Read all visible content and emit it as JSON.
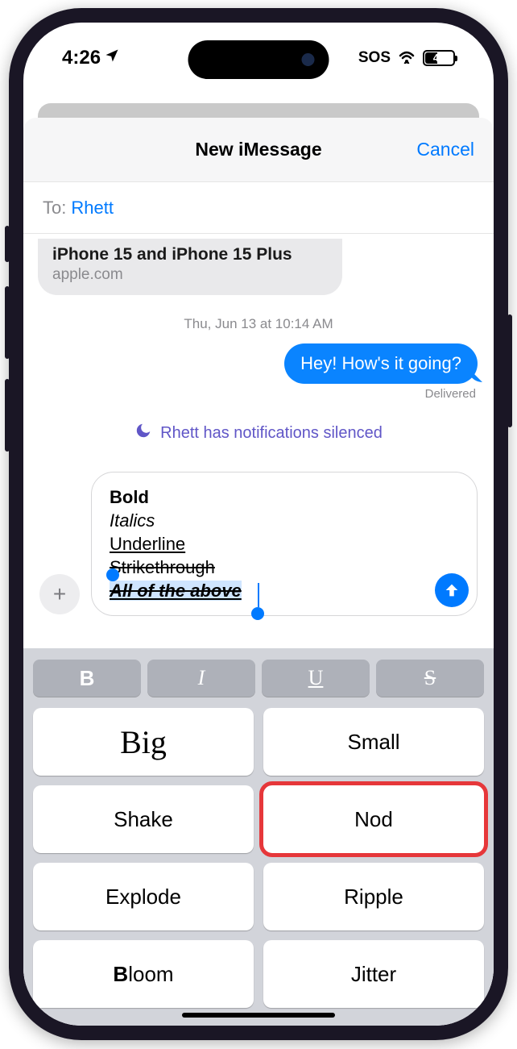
{
  "status": {
    "time": "4:26",
    "sos": "SOS",
    "battery_pct": "43"
  },
  "nav": {
    "title": "New iMessage",
    "cancel": "Cancel"
  },
  "to": {
    "label": "To:",
    "name": "Rhett"
  },
  "link_preview": {
    "title": "iPhone 15 and iPhone 15 Plus",
    "domain": "apple.com"
  },
  "timestamp": "Thu, Jun 13 at 10:14 AM",
  "message_out": "Hey! How's it going?",
  "delivered": "Delivered",
  "silenced": "Rhett has notifications silenced",
  "compose": {
    "line1": "Bold",
    "line2": "Italics",
    "line3": "Underline",
    "line4": "Strikethrough",
    "line5": "All of the above"
  },
  "format": {
    "bold": "B",
    "italic": "I",
    "underline": "U",
    "strike": "S"
  },
  "effects": {
    "big": "Big",
    "small": "Small",
    "shake": "Shake",
    "nod": "Nod",
    "explode": "Explode",
    "ripple": "Ripple",
    "bloom_b": "B",
    "bloom_rest": "loom",
    "jitter": "Jitter"
  }
}
